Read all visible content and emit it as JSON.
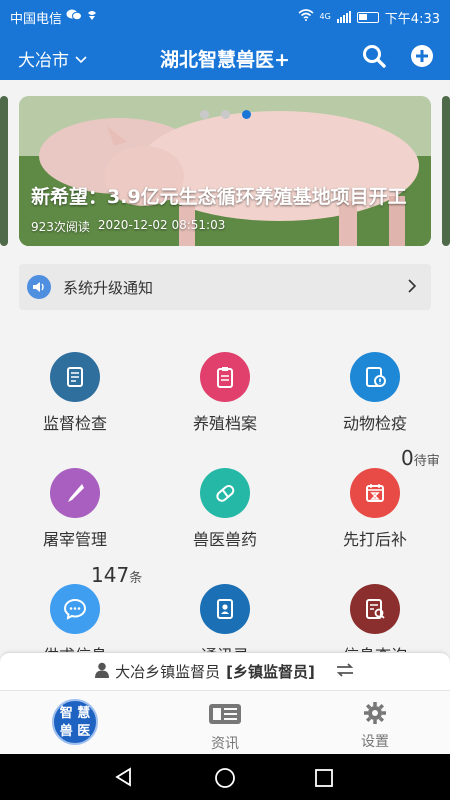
{
  "statusbar": {
    "carrier": "中国电信",
    "network": "4G",
    "time": "下午4:33"
  },
  "header": {
    "city": "大冶市",
    "title": "湖北智慧兽医+"
  },
  "banner": {
    "headline": "新希望：3.9亿元生态循环养殖基地项目开工",
    "reads": "923次阅读",
    "date": "2020-12-02 08:51:03",
    "slide_count": 3,
    "active_slide": 3
  },
  "notice": {
    "label": "系统升级通知"
  },
  "grid": [
    {
      "label": "监督检查",
      "icon": "document-scroll-icon",
      "color": "#2e6f9e"
    },
    {
      "label": "养殖档案",
      "icon": "clipboard-icon",
      "color": "#e0406b"
    },
    {
      "label": "动物检疫",
      "icon": "inspection-icon",
      "color": "#1e88d6"
    },
    {
      "label": "屠宰管理",
      "icon": "knife-icon",
      "color": "#a85fc0"
    },
    {
      "label": "兽医兽药",
      "icon": "pill-icon",
      "color": "#25b8a6"
    },
    {
      "label": "先打后补",
      "icon": "calendar-hourglass-icon",
      "color": "#e84b45"
    },
    {
      "label": "供求信息",
      "icon": "chat-bubble-icon",
      "color": "#3f9ef0"
    },
    {
      "label": "通讯录",
      "icon": "contact-book-icon",
      "color": "#1a6fb5"
    },
    {
      "label": "信息查询",
      "icon": "search-list-icon",
      "color": "#8a2e2e"
    }
  ],
  "badges": {
    "quarantine": {
      "count": "0",
      "unit": "待审"
    },
    "supply": {
      "count": "147",
      "unit": "条"
    }
  },
  "user": {
    "name": "大冶乡镇监督员",
    "role": "[乡镇监督员]"
  },
  "tabs": [
    {
      "label": "智慧兽医",
      "icon": "app-logo"
    },
    {
      "label": "资讯",
      "icon": "news-icon"
    },
    {
      "label": "设置",
      "icon": "gear-icon"
    }
  ],
  "logo_text": {
    "line1": "智 慧",
    "line2": "兽 医"
  }
}
